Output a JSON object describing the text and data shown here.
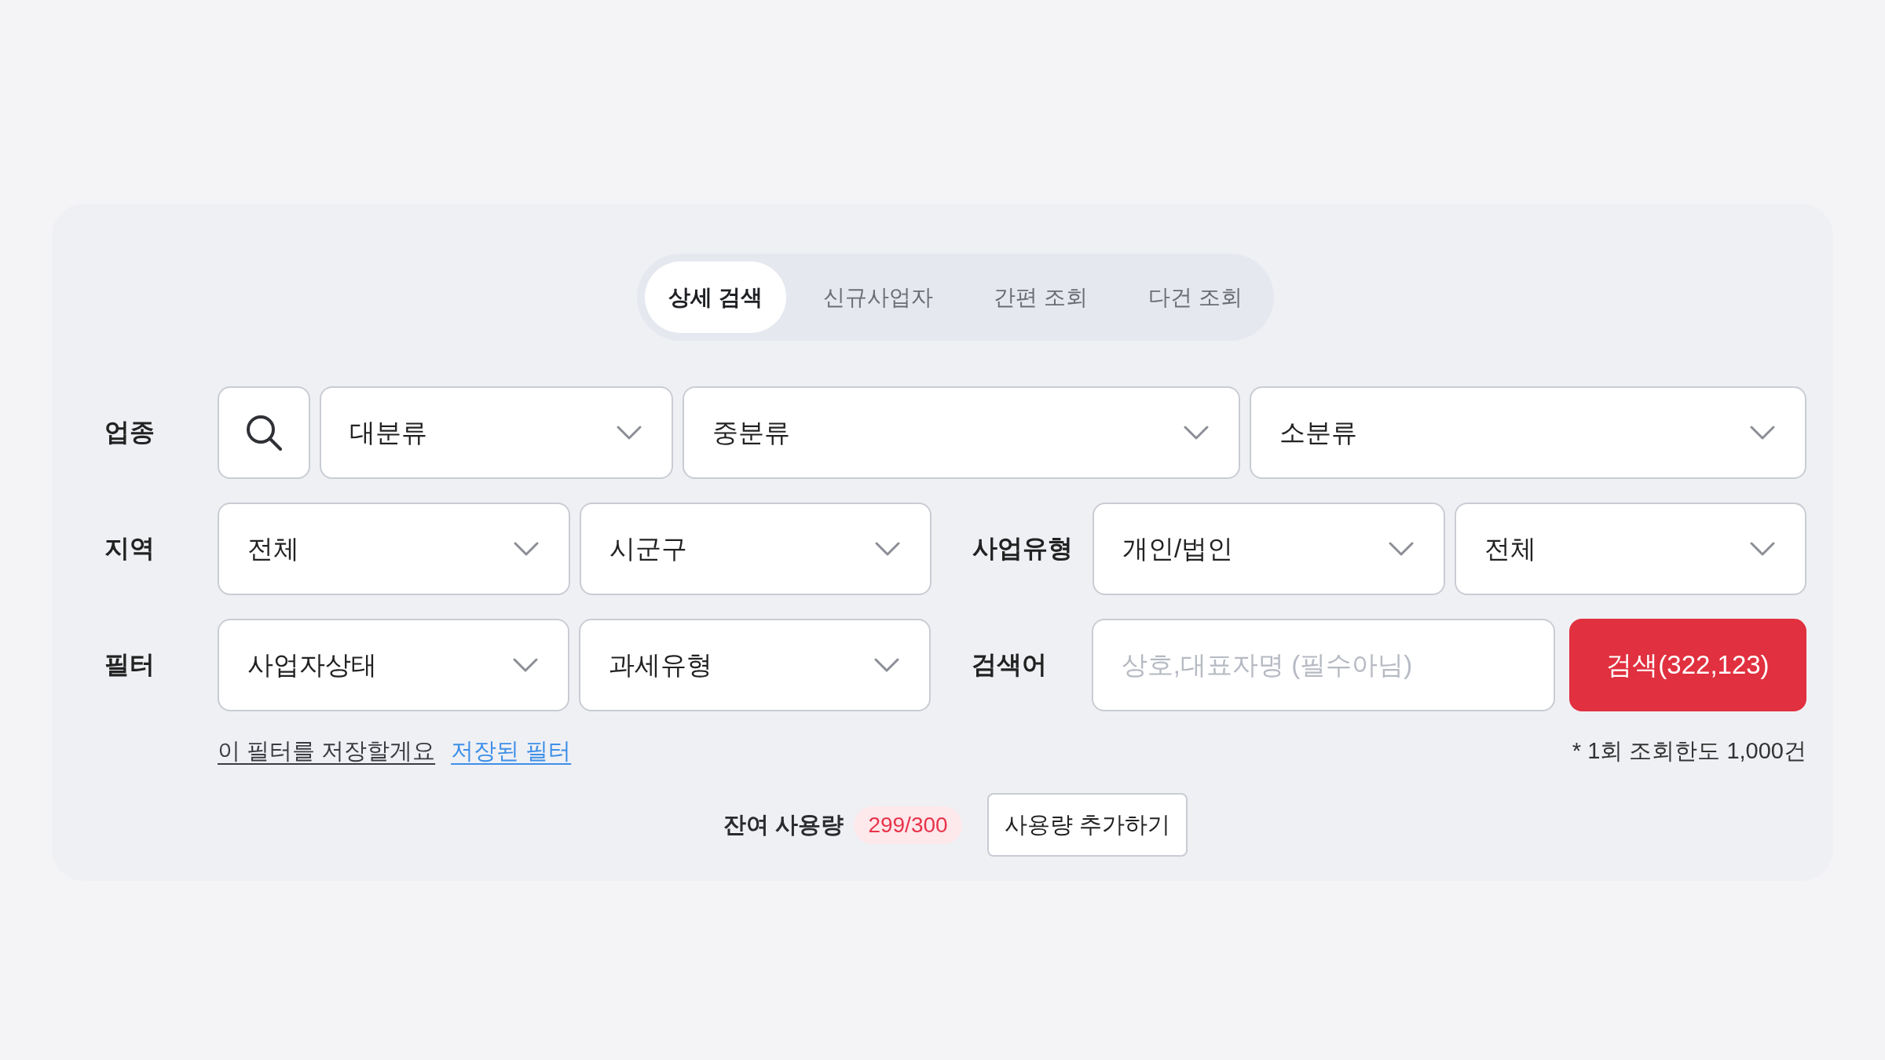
{
  "tabs": [
    {
      "label": "상세 검색",
      "selected": true
    },
    {
      "label": "신규사업자",
      "selected": false
    },
    {
      "label": "간편 조회",
      "selected": false
    },
    {
      "label": "다건 조회",
      "selected": false
    }
  ],
  "rows": [
    {
      "groups": [
        {
          "label": "업종",
          "fields": [
            {
              "kind": "icon_button"
            },
            {
              "kind": "select",
              "value": "대분류"
            },
            {
              "kind": "select",
              "value": "중분류"
            },
            {
              "kind": "select",
              "value": "소분류"
            }
          ]
        }
      ]
    },
    {
      "groups": [
        {
          "label": "지역",
          "fields": [
            {
              "kind": "select",
              "value": "전체"
            },
            {
              "kind": "select",
              "value": "시군구"
            }
          ]
        },
        {
          "label": "사업유형",
          "fields": [
            {
              "kind": "select",
              "value": "개인/법인"
            },
            {
              "kind": "select",
              "value": "전체"
            }
          ]
        }
      ]
    },
    {
      "groups": [
        {
          "label": "필터",
          "fields": [
            {
              "kind": "select",
              "value": "사업자상태"
            },
            {
              "kind": "select",
              "value": "과세유형"
            }
          ]
        },
        {
          "label": "검색어",
          "fields": [
            {
              "kind": "text_input",
              "placeholder": "상호,대표자명 (필수아님)"
            },
            {
              "kind": "button",
              "label": "검색(322,123)"
            }
          ]
        }
      ]
    }
  ],
  "filter_links": [
    {
      "kind": "plain",
      "label": "이 필터를 저장할게요"
    },
    {
      "kind": "accent",
      "label": "저장된 필터"
    }
  ],
  "limit_note": "* 1회 조회한도 1,000건",
  "usage": {
    "label": "잔여 사용량",
    "count": "299/300",
    "button": "사용량 추가하기"
  }
}
